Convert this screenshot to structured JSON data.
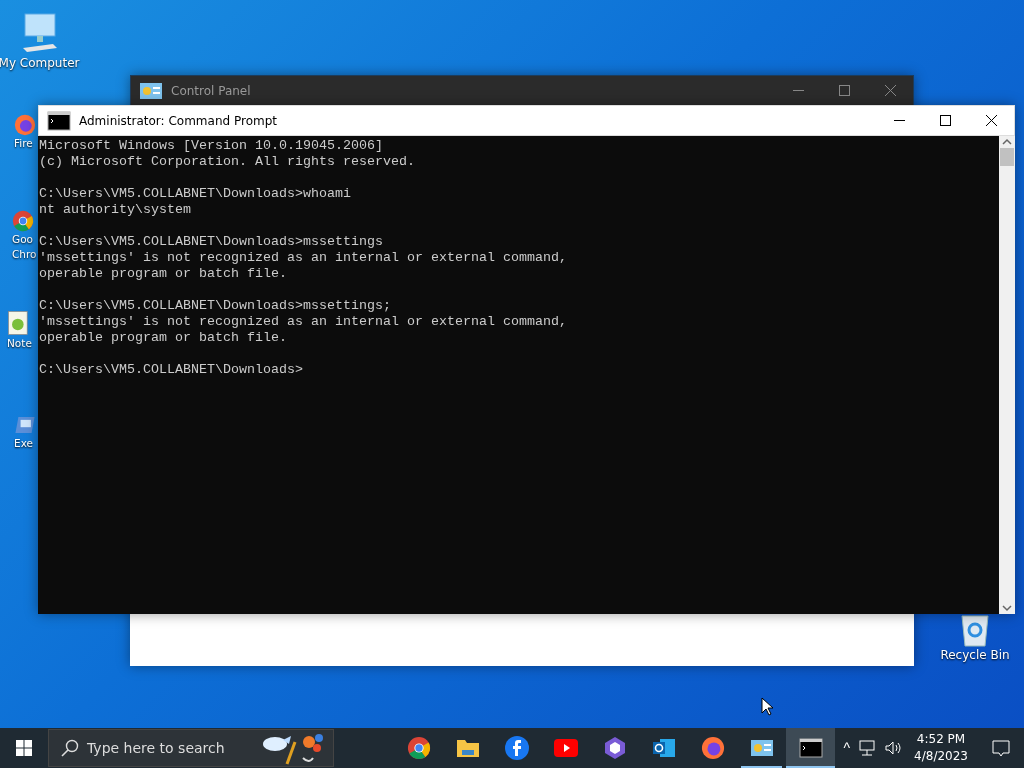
{
  "desktop_icons": [
    {
      "kind": "computer",
      "lines": [
        "My Computer"
      ]
    },
    {
      "kind": "firefox",
      "lines": [
        "Fire"
      ]
    },
    {
      "kind": "chrome",
      "lines": [
        "Goo",
        "Chro"
      ]
    },
    {
      "kind": "notepad",
      "lines": [
        "Note"
      ]
    },
    {
      "kind": "exe",
      "lines": [
        "Exe"
      ]
    },
    {
      "kind": "recycle",
      "lines": [
        "Recycle Bin"
      ]
    }
  ],
  "back_window": {
    "title": "Control Panel"
  },
  "window": {
    "title": "Administrator:  Command Prompt",
    "console_blocks": [
      [
        "Microsoft Windows [Version 10.0.19045.2006]",
        "(c) Microsoft Corporation. All rights reserved."
      ],
      [
        "C:\\Users\\VM5.COLLABNET\\Downloads>whoami",
        "nt authority\\system"
      ],
      [
        "C:\\Users\\VM5.COLLABNET\\Downloads>mssettings",
        "'mssettings' is not recognized as an internal or external command,",
        "operable program or batch file."
      ],
      [
        "C:\\Users\\VM5.COLLABNET\\Downloads>mssettings;",
        "'mssettings' is not recognized as an internal or external command,",
        "operable program or batch file."
      ],
      [
        "C:\\Users\\VM5.COLLABNET\\Downloads>"
      ]
    ]
  },
  "taskbar": {
    "search": {
      "placeholder": "Type here to search"
    },
    "apps": [
      {
        "kind": "chrome",
        "running": false,
        "selected": false
      },
      {
        "kind": "folder",
        "running": false,
        "selected": false
      },
      {
        "kind": "facebook",
        "running": false,
        "selected": false
      },
      {
        "kind": "youtube",
        "running": false,
        "selected": false
      },
      {
        "kind": "hex",
        "running": false,
        "selected": false
      },
      {
        "kind": "outlook",
        "running": false,
        "selected": false
      },
      {
        "kind": "firefox",
        "running": false,
        "selected": false
      },
      {
        "kind": "control",
        "running": true,
        "selected": false
      },
      {
        "kind": "cmd",
        "running": true,
        "selected": true
      }
    ],
    "tray": {
      "caret": "^",
      "time": "4:52 PM",
      "date": "4/8/2023"
    }
  }
}
